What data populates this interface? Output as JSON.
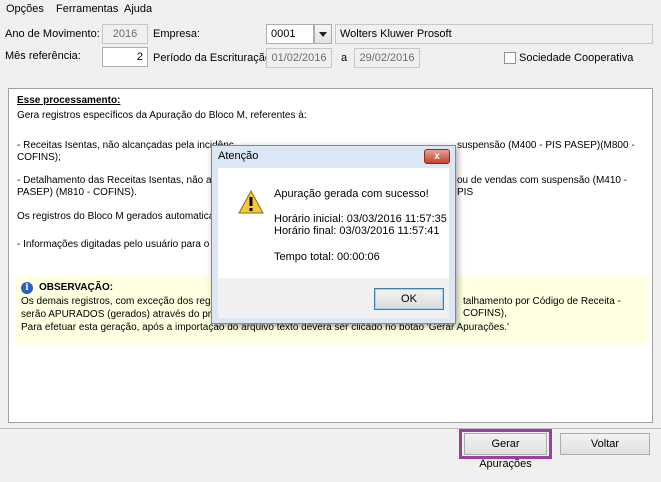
{
  "menu": {
    "opcoes": "Opções",
    "ferramentas": "Ferramentas",
    "ajuda": "Ajuda"
  },
  "form": {
    "ano_label": "Ano de Movimento:",
    "ano_value": "2016",
    "empresa_label": "Empresa:",
    "empresa_code": "0001",
    "empresa_name": "Wolters Kluwer Prosoft",
    "mes_label": "Mês referência:",
    "mes_value": "2",
    "periodo_label": "Período da Escrituração:",
    "periodo_inicio": "01/02/2016",
    "periodo_sep": "a",
    "periodo_fim": "29/02/2016",
    "cooperativa_label": "Sociedade Cooperativa"
  },
  "panel": {
    "title": "Esse processamento:",
    "line1": "Gera registros específicos da Apuração do Bloco M, referentes à:",
    "line2a": "- Receitas Isentas, não alcançadas pela incidênc",
    "line2b": "suspensão (M400 - PIS PASEP)(M800 -",
    "line2c": "COFINS);",
    "line3a": "- Detalhamento das Receitas Isentas, não alcanç",
    "line3b": "ou de vendas com suspensão (M410 - PIS",
    "line3c": "PASEP) (M810 - COFINS).",
    "line4": "Os registros do Bloco M gerados automaticament",
    "line5": "- Informações digitadas pelo usuário para o Bloco",
    "obs_title": "OBSERVAÇÃO:",
    "obs1a": "Os demais registros, com exceção dos registros",
    "obs1b": "talhamento por Código de Receita - COFINS),",
    "obs2": "serão APURADOS (gerados) através do program",
    "obs3": "Para efetuar esta geração, após a importação do arquivo texto deverá ser clicado no botão 'Gerar Apurações.'"
  },
  "buttons": {
    "gerar": "Gerar Apurações",
    "voltar": "Voltar"
  },
  "dialog": {
    "title": "Atenção",
    "close": "x",
    "message": "Apuração gerada com sucesso!",
    "inicial": "Horário inicial: 03/03/2016 11:57:35",
    "final": "Horário final: 03/03/2016 11:57:41",
    "total": "Tempo total: 00:00:06",
    "ok": "OK"
  },
  "colors": {
    "highlight": "#9b3fa0",
    "obs_bg": "#ffffe1",
    "info_icon": "#2a5fc7"
  }
}
